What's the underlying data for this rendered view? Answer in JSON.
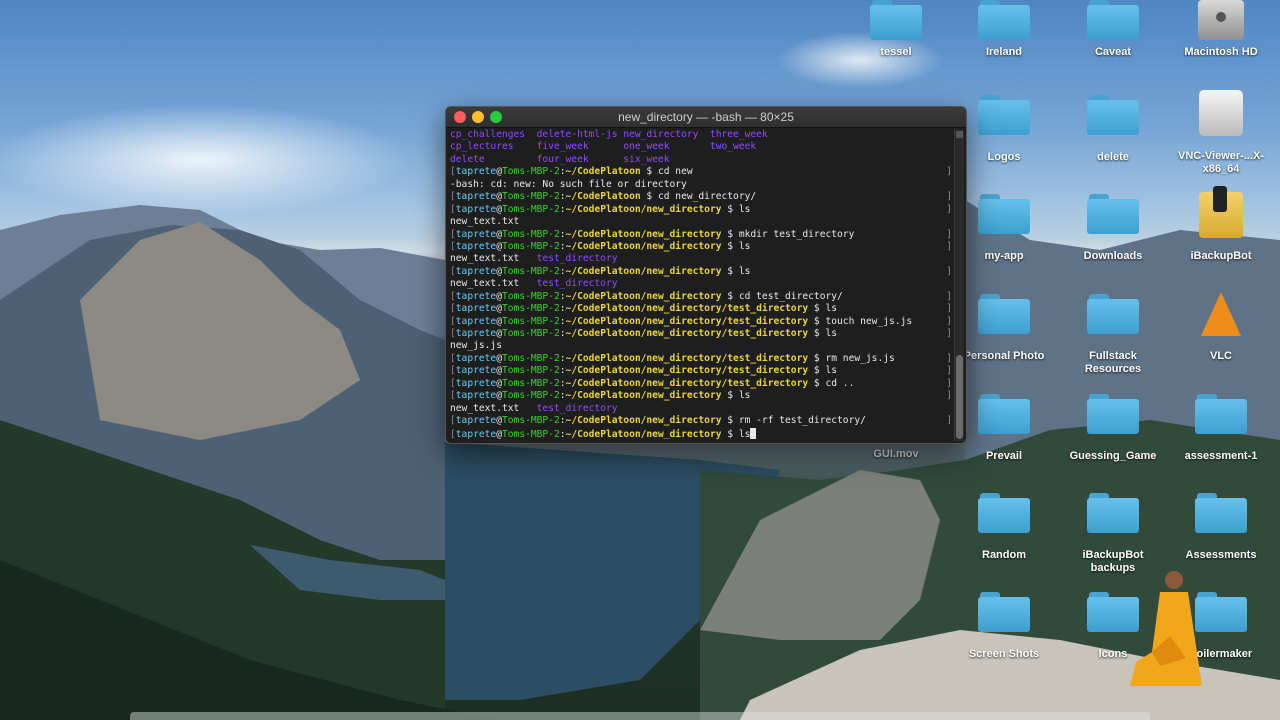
{
  "terminal": {
    "title": "new_directory — -bash — 80×25",
    "lines": [
      {
        "type": "ls-cols",
        "cols": [
          "cp_challenges",
          "delete-html-js",
          "new_directory",
          "three_week"
        ]
      },
      {
        "type": "ls-cols",
        "cols": [
          "cp_lectures",
          "five_week",
          "one_week",
          "two_week"
        ]
      },
      {
        "type": "ls-cols",
        "cols": [
          "delete",
          "four_week",
          "six_week",
          ""
        ]
      },
      {
        "type": "prompt",
        "user": "taprete",
        "host": "Toms-MBP-2",
        "path": "~/CodePlatoon",
        "cmd": "cd new"
      },
      {
        "type": "text",
        "text": "-bash: cd: new: No such file or directory"
      },
      {
        "type": "prompt",
        "user": "taprete",
        "host": "Toms-MBP-2",
        "path": "~/CodePlatoon",
        "cmd": "cd new_directory/"
      },
      {
        "type": "prompt",
        "user": "taprete",
        "host": "Toms-MBP-2",
        "path": "~/CodePlatoon/new_directory",
        "cmd": "ls"
      },
      {
        "type": "text",
        "text": "new_text.txt"
      },
      {
        "type": "prompt",
        "user": "taprete",
        "host": "Toms-MBP-2",
        "path": "~/CodePlatoon/new_directory",
        "cmd": "mkdir test_directory"
      },
      {
        "type": "prompt",
        "user": "taprete",
        "host": "Toms-MBP-2",
        "path": "~/CodePlatoon/new_directory",
        "cmd": "ls"
      },
      {
        "type": "ls-pair",
        "file": "new_text.txt",
        "dir": "test_directory"
      },
      {
        "type": "prompt",
        "user": "taprete",
        "host": "Toms-MBP-2",
        "path": "~/CodePlatoon/new_directory",
        "cmd": "ls"
      },
      {
        "type": "ls-pair",
        "file": "new_text.txt",
        "dir": "test_directory"
      },
      {
        "type": "prompt",
        "user": "taprete",
        "host": "Toms-MBP-2",
        "path": "~/CodePlatoon/new_directory",
        "cmd": "cd test_directory/"
      },
      {
        "type": "prompt",
        "user": "taprete",
        "host": "Toms-MBP-2",
        "path": "~/CodePlatoon/new_directory/test_directory",
        "cmd": "ls"
      },
      {
        "type": "prompt",
        "user": "taprete",
        "host": "Toms-MBP-2",
        "path": "~/CodePlatoon/new_directory/test_directory",
        "cmd": "touch new_js.js"
      },
      {
        "type": "prompt",
        "user": "taprete",
        "host": "Toms-MBP-2",
        "path": "~/CodePlatoon/new_directory/test_directory",
        "cmd": "ls"
      },
      {
        "type": "text",
        "text": "new_js.js"
      },
      {
        "type": "prompt",
        "user": "taprete",
        "host": "Toms-MBP-2",
        "path": "~/CodePlatoon/new_directory/test_directory",
        "cmd": "rm new_js.js"
      },
      {
        "type": "prompt",
        "user": "taprete",
        "host": "Toms-MBP-2",
        "path": "~/CodePlatoon/new_directory/test_directory",
        "cmd": "ls"
      },
      {
        "type": "prompt",
        "user": "taprete",
        "host": "Toms-MBP-2",
        "path": "~/CodePlatoon/new_directory/test_directory",
        "cmd": "cd .."
      },
      {
        "type": "prompt",
        "user": "taprete",
        "host": "Toms-MBP-2",
        "path": "~/CodePlatoon/new_directory",
        "cmd": "ls"
      },
      {
        "type": "ls-pair",
        "file": "new_text.txt",
        "dir": "test_directory"
      },
      {
        "type": "prompt",
        "user": "taprete",
        "host": "Toms-MBP-2",
        "path": "~/CodePlatoon/new_directory",
        "cmd": "rm -rf test_directory/"
      },
      {
        "type": "prompt-active",
        "user": "taprete",
        "host": "Toms-MBP-2",
        "path": "~/CodePlatoon/new_directory",
        "cmd": "ls"
      }
    ]
  },
  "desktop": {
    "icons": [
      {
        "label": "tessel",
        "kind": "folder"
      },
      {
        "label": "Ireland",
        "kind": "folder"
      },
      {
        "label": "Caveat",
        "kind": "folder"
      },
      {
        "label": "Macintosh HD",
        "kind": "harddrive"
      },
      {
        "label": "Logos",
        "kind": "folder"
      },
      {
        "label": "delete",
        "kind": "folder"
      },
      {
        "label": "VNC-Viewer-...X-x86_64",
        "kind": "disk-image"
      },
      {
        "label": "my-app",
        "kind": "folder"
      },
      {
        "label": "Downloads",
        "kind": "folder"
      },
      {
        "label": "iBackupBot",
        "kind": "app"
      },
      {
        "label": "Personal Photo",
        "kind": "folder"
      },
      {
        "label": "Fullstack Resources",
        "kind": "folder"
      },
      {
        "label": "VLC",
        "kind": "app-cone"
      },
      {
        "label": "GUI.mov",
        "kind": "movie"
      },
      {
        "label": "Prevail",
        "kind": "folder"
      },
      {
        "label": "Guessing_Game",
        "kind": "folder"
      },
      {
        "label": "assessment-1",
        "kind": "folder"
      },
      {
        "label": "Random",
        "kind": "folder"
      },
      {
        "label": "iBackupBot backups",
        "kind": "folder"
      },
      {
        "label": "Assessments",
        "kind": "folder"
      },
      {
        "label": "Screen Shots",
        "kind": "folder"
      },
      {
        "label": "Icons",
        "kind": "folder"
      },
      {
        "label": "boilermaker",
        "kind": "folder"
      }
    ]
  },
  "colors": {
    "prompt_user": "#5dd0ff",
    "prompt_host": "#3ad12d",
    "prompt_path": "#e8d53a",
    "directory": "#8f4cff",
    "terminal_bg": "#1e1e1e",
    "folder": "#4fb0df"
  }
}
